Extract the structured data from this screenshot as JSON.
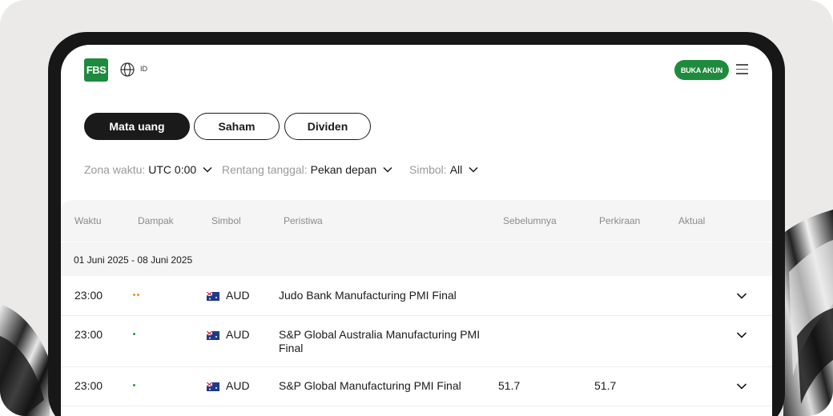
{
  "header": {
    "logo_text": "FBS",
    "language": "ID",
    "open_account_label": "BUKA AKUN"
  },
  "tabs": [
    {
      "label": "Mata uang",
      "active": true
    },
    {
      "label": "Saham",
      "active": false
    },
    {
      "label": "Dividen",
      "active": false
    }
  ],
  "filters": {
    "timezone": {
      "label": "Zona waktu:",
      "value": "UTC 0:00"
    },
    "range": {
      "label": "Rentang tanggal:",
      "value": "Pekan depan"
    },
    "symbol": {
      "label": "Simbol:",
      "value": "All"
    }
  },
  "table": {
    "columns": [
      "Waktu",
      "Dampak",
      "Simbol",
      "Peristiwa",
      "Sebelumnya",
      "Perkiraan",
      "Aktual"
    ],
    "date_range": "01 Juni 2025 - 08 Juni 2025",
    "rows": [
      {
        "time": "23:00",
        "impact": 2,
        "impact_color": "#f28c28",
        "symbol": "AUD",
        "event": "Judo Bank Manufacturing PMI Final",
        "previous": "",
        "forecast": "",
        "actual": ""
      },
      {
        "time": "23:00",
        "impact": 1,
        "impact_color": "#1e9e45",
        "symbol": "AUD",
        "event": "S&P Global Australia Manufacturing PMI Final",
        "previous": "",
        "forecast": "",
        "actual": ""
      },
      {
        "time": "23:00",
        "impact": 1,
        "impact_color": "#1e9e45",
        "symbol": "AUD",
        "event": "S&P Global Manufacturing PMI Final",
        "previous": "51.7",
        "forecast": "51.7",
        "actual": ""
      }
    ]
  },
  "colors": {
    "brand": "#1e8a3d",
    "dark": "#1a1a1a",
    "muted": "#9a9a9a"
  }
}
